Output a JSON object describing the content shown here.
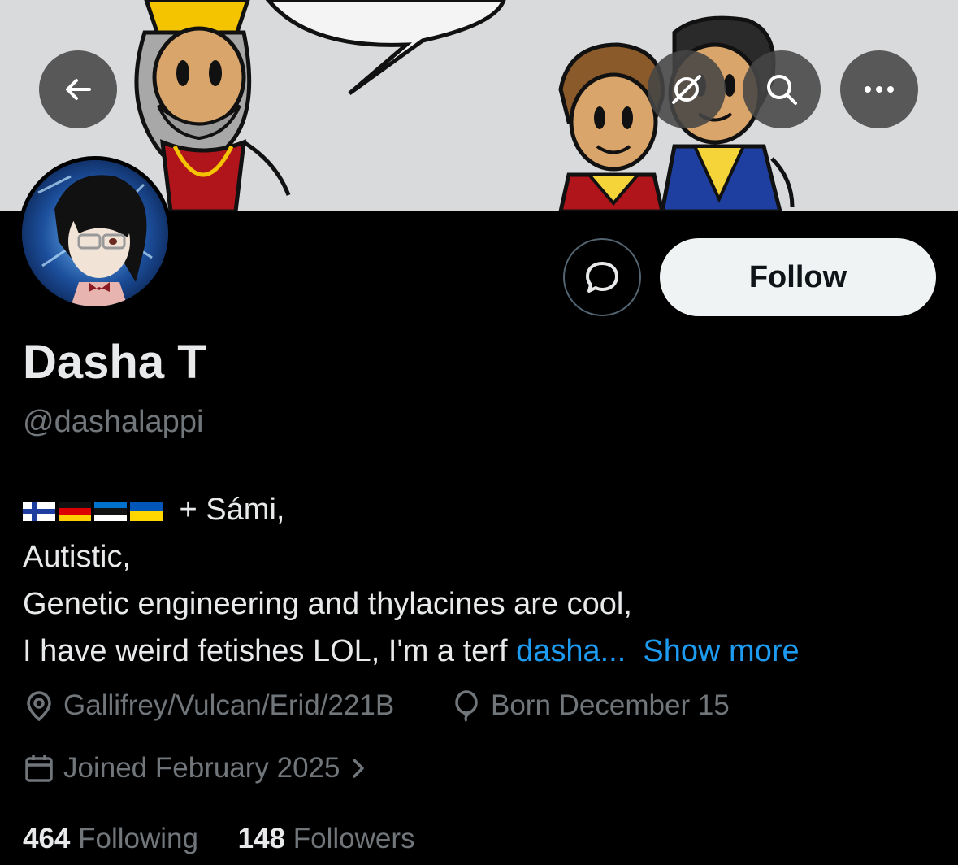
{
  "header": {
    "back_icon": "arrow-left-icon",
    "grok_icon": "grok-icon",
    "search_icon": "search-icon",
    "more_icon": "more-horizontal-icon"
  },
  "profile": {
    "name": "Dasha T",
    "handle": "@dashalappi",
    "follow_label": "Follow",
    "message_icon": "message-icon"
  },
  "bio": {
    "flags": [
      "Finland",
      "Germany",
      "Estonia",
      "Ukraine"
    ],
    "line1_text": " + Sámi,",
    "line2": "Autistic,",
    "line3": "Genetic engineering and thylacines are cool,",
    "line4_text": "I have weird fetishes LOL, I'm a terf ",
    "line4_link": "dasha...",
    "show_more": "Show more"
  },
  "meta": {
    "location": "Gallifrey/Vulcan/Erid/221B",
    "birthday": "Born December 15",
    "joined": "Joined February 2025"
  },
  "stats": {
    "following_count": "464",
    "following_label": "Following",
    "followers_count": "148",
    "followers_label": "Followers"
  },
  "colors": {
    "background": "#000000",
    "link": "#1d9bf0",
    "secondary_text": "#71767b",
    "follow_bg": "#eff3f4"
  }
}
